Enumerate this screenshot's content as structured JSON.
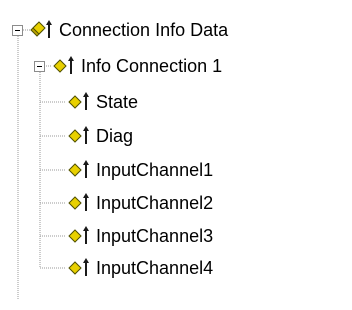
{
  "tree": {
    "root": {
      "label": "Connection Info Data",
      "expanded": true,
      "icon": "stacked-diamond-arrow-icon"
    },
    "connection": {
      "label": "Info Connection 1",
      "expanded": true,
      "icon": "diamond-arrow-icon"
    },
    "items": [
      {
        "label": "State",
        "icon": "diamond-arrow-icon"
      },
      {
        "label": "Diag",
        "icon": "diamond-arrow-icon"
      },
      {
        "label": "InputChannel1",
        "icon": "diamond-arrow-icon"
      },
      {
        "label": "InputChannel2",
        "icon": "diamond-arrow-icon"
      },
      {
        "label": "InputChannel3",
        "icon": "diamond-arrow-icon"
      },
      {
        "label": "InputChannel4",
        "icon": "diamond-arrow-icon"
      }
    ]
  },
  "colors": {
    "diamond_fill": "#e8d000",
    "diamond_outline": "#505000",
    "arrow": "#1a1a1a",
    "connector": "#9a9a9a"
  }
}
